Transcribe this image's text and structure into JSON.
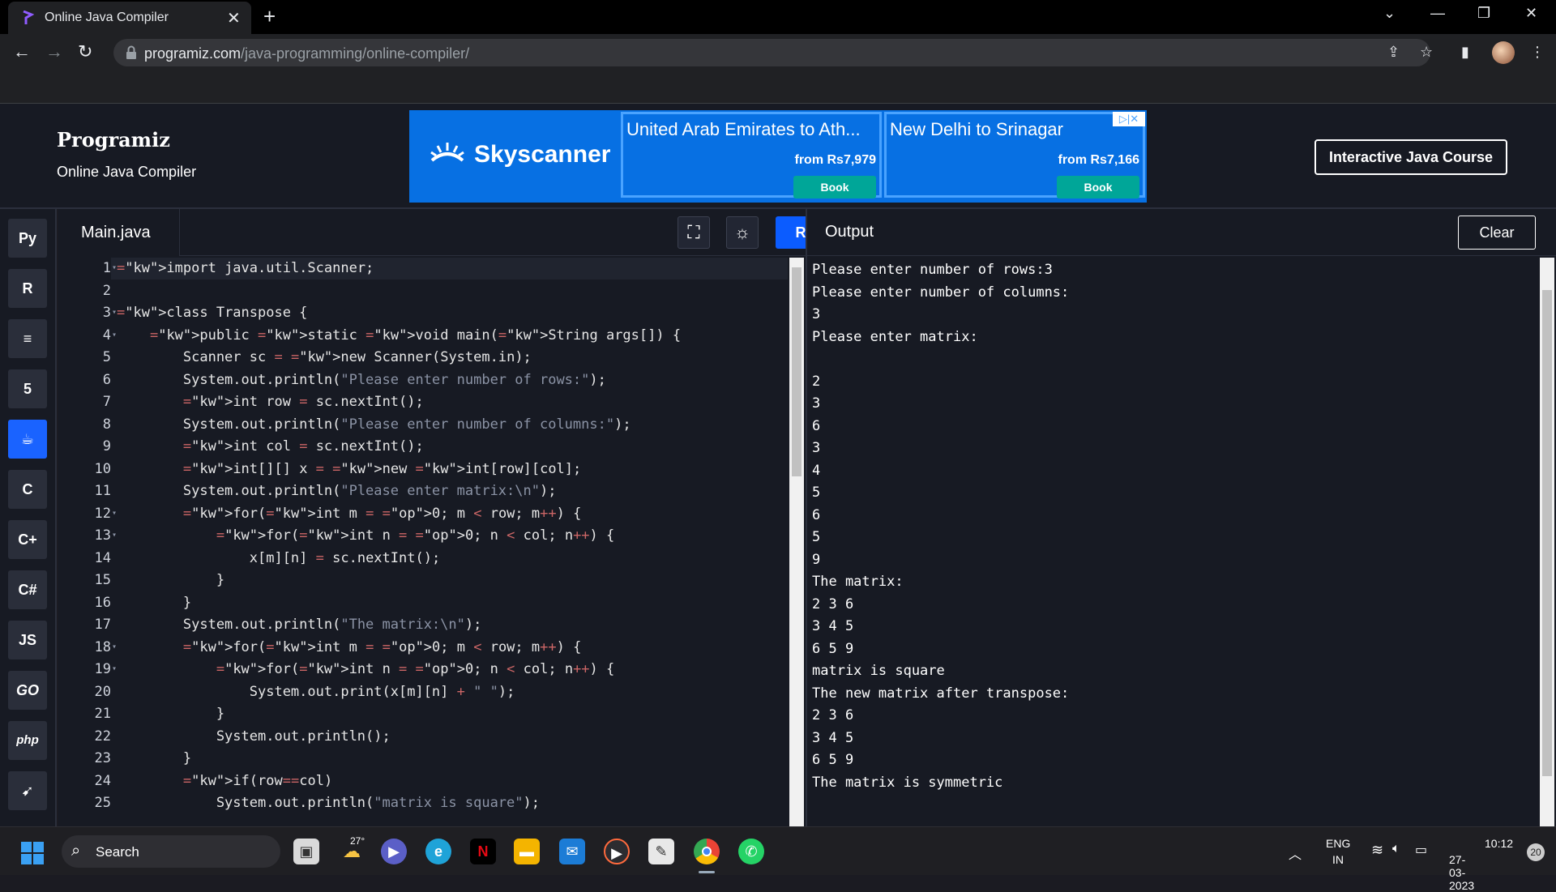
{
  "browser": {
    "tab_title": "Online Java Compiler",
    "url_domain": "programiz.com",
    "url_path": "/java-programming/online-compiler/"
  },
  "site": {
    "logo": "Programiz",
    "subtitle": "Online Java Compiler",
    "course_button": "Interactive Java Course"
  },
  "ad": {
    "brand": "Skyscanner",
    "cards": [
      {
        "dest": "United Arab Emirates to Ath...",
        "price": "from Rs7,979",
        "button": "Book"
      },
      {
        "dest": "New Delhi to Srinagar",
        "price": "from Rs7,166",
        "button": "Book"
      }
    ],
    "adchoices": "▷|✕"
  },
  "sidebar": {
    "langs": [
      "python-icon",
      "r-icon",
      "sql-icon",
      "html-icon",
      "java-icon",
      "c-icon",
      "cpp-icon",
      "csharp-icon",
      "js-icon",
      "go-icon",
      "php-icon",
      "swift-icon"
    ],
    "labels": [
      "Py",
      "R",
      "≡",
      "5",
      "☕",
      "C",
      "C+",
      "C#",
      "JS",
      "GO",
      "php",
      "➹"
    ]
  },
  "editor": {
    "filename": "Main.java",
    "run_label": "Run",
    "lines": [
      "import java.util.Scanner;",
      "",
      "class Transpose {",
      "    public static void main(String args[]) {",
      "        Scanner sc = new Scanner(System.in);",
      "        System.out.println(\"Please enter number of rows:\");",
      "        int row = sc.nextInt();",
      "        System.out.println(\"Please enter number of columns:\");",
      "        int col = sc.nextInt();",
      "        int[][] x = new int[row][col];",
      "        System.out.println(\"Please enter matrix:\\n\");",
      "        for(int m = 0; m < row; m++) {",
      "            for(int n = 0; n < col; n++) {",
      "                x[m][n] = sc.nextInt();",
      "            }",
      "        }",
      "        System.out.println(\"The matrix:\\n\");",
      "        for(int m = 0; m < row; m++) {",
      "            for(int n = 0; n < col; n++) {",
      "                System.out.print(x[m][n] + \" \");",
      "            }",
      "            System.out.println();",
      "        }",
      "        if(row==col)",
      "            System.out.println(\"matrix is square\");"
    ],
    "folds": [
      1,
      3,
      4,
      12,
      13,
      18,
      19
    ]
  },
  "output": {
    "title": "Output",
    "clear_label": "Clear",
    "text": "Please enter number of rows:3\nPlease enter number of columns:\n3\nPlease enter matrix:\n\n2\n3\n6\n3\n4\n5\n6\n5\n9\nThe matrix:\n2 3 6\n3 4 5\n6 5 9\nmatrix is square\nThe new matrix after transpose:\n2 3 6\n3 4 5\n6 5 9\nThe matrix is symmetric"
  },
  "taskbar": {
    "search_label": "Search",
    "weather_temp": "27°",
    "lang_line1": "ENG",
    "lang_line2": "IN",
    "time": "10:12",
    "date": "27-03-2023",
    "notif_count": "20"
  },
  "colors": {
    "accent": "#0b5cff",
    "background": "#171a23",
    "ad_blue": "#0770e3",
    "book_teal": "#00a698"
  }
}
